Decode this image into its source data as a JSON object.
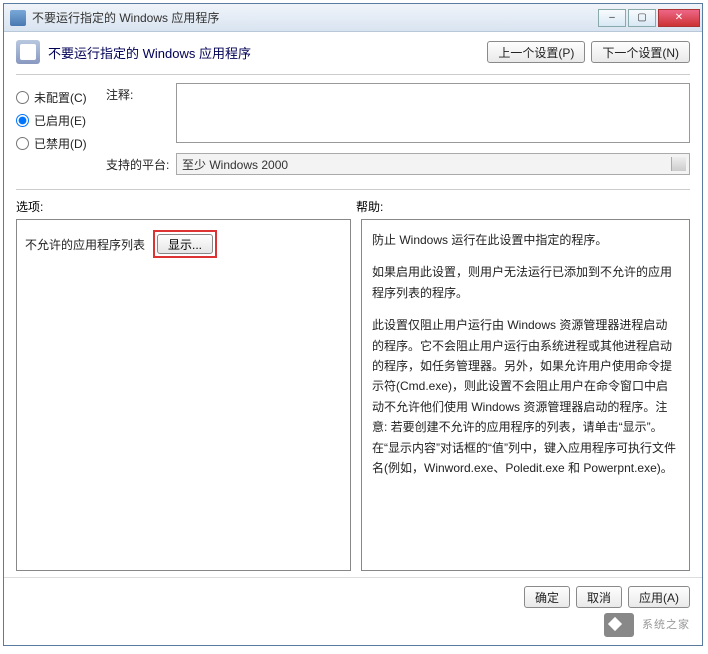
{
  "window": {
    "title": "不要运行指定的 Windows 应用程序",
    "minimize": "–",
    "maximize": "▢",
    "close": "✕"
  },
  "header": {
    "title": "不要运行指定的 Windows 应用程序",
    "prev_btn": "上一个设置(P)",
    "next_btn": "下一个设置(N)"
  },
  "radios": {
    "not_configured": "未配置(C)",
    "enabled": "已启用(E)",
    "disabled": "已禁用(D)",
    "selected": "enabled"
  },
  "fields": {
    "comment_label": "注释:",
    "comment_value": "",
    "platform_label": "支持的平台:",
    "platform_value": "至少 Windows 2000"
  },
  "sections": {
    "options_label": "选项:",
    "help_label": "帮助:"
  },
  "options_panel": {
    "list_label": "不允许的应用程序列表",
    "show_btn": "显示..."
  },
  "help_panel": {
    "p1": "防止 Windows 运行在此设置中指定的程序。",
    "p2": "如果启用此设置，则用户无法运行已添加到不允许的应用程序列表的程序。",
    "p3": "此设置仅阻止用户运行由 Windows 资源管理器进程启动的程序。它不会阻止用户运行由系统进程或其他进程启动的程序，如任务管理器。另外，如果允许用户使用命令提示符(Cmd.exe)，则此设置不会阻止用户在命令窗口中启动不允许他们使用 Windows 资源管理器启动的程序。注意: 若要创建不允许的应用程序的列表，请单击“显示”。在“显示内容”对话框的“值”列中，键入应用程序可执行文件名(例如，Winword.exe、Poledit.exe 和 Powerpnt.exe)。"
  },
  "footer": {
    "ok": "确定",
    "cancel": "取消",
    "apply": "应用(A)"
  },
  "watermark": "系统之家"
}
